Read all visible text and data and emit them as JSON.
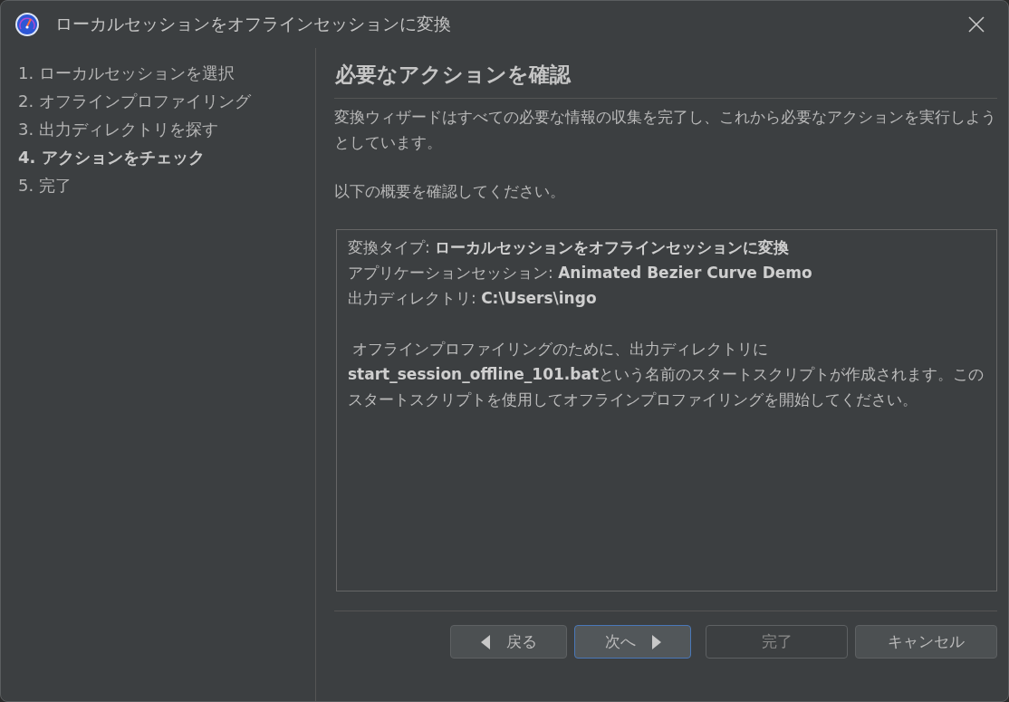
{
  "window": {
    "title": "ローカルセッションをオフラインセッションに変換"
  },
  "steps": [
    {
      "label": "1. ローカルセッションを選択",
      "selected": false
    },
    {
      "label": "2. オフラインプロファイリング",
      "selected": false
    },
    {
      "label": "3. 出力ディレクトリを探す",
      "selected": false
    },
    {
      "label": "4. アクションをチェック",
      "selected": true
    },
    {
      "label": "5. 完了",
      "selected": false
    }
  ],
  "page": {
    "heading": "必要なアクションを確認",
    "intro": [
      "変換ウィザードはすべての必要な情報の収集を完了し、これから必要なアクションを実行しようとしています。",
      "以下の概要を確認してください。"
    ],
    "summary": {
      "lines": [
        "変換タイプ: **ローカルセッションをオフラインセッションに変換**",
        "アプリケーションセッション: **Animated Bezier Curve Demo**",
        "出力ディレクトリ: **C:\\Users\\ingo**"
      ],
      "note": " オフラインプロファイリングのために、出力ディレクトリに**start_session_offline_101.bat**という名前のスタートスクリプトが作成されます。このスタートスクリプトを使用してオフラインプロファイリングを開始してください。"
    }
  },
  "buttons": [
    {
      "kind": "back",
      "label": "戻る",
      "focused": false,
      "disabled": false
    },
    {
      "kind": "next",
      "label": "次へ",
      "focused": true,
      "disabled": false
    },
    {
      "kind": "finish",
      "label": "完了",
      "focused": false,
      "disabled": true
    },
    {
      "kind": "cancel",
      "label": "キャンセル",
      "focused": false,
      "disabled": false
    }
  ]
}
